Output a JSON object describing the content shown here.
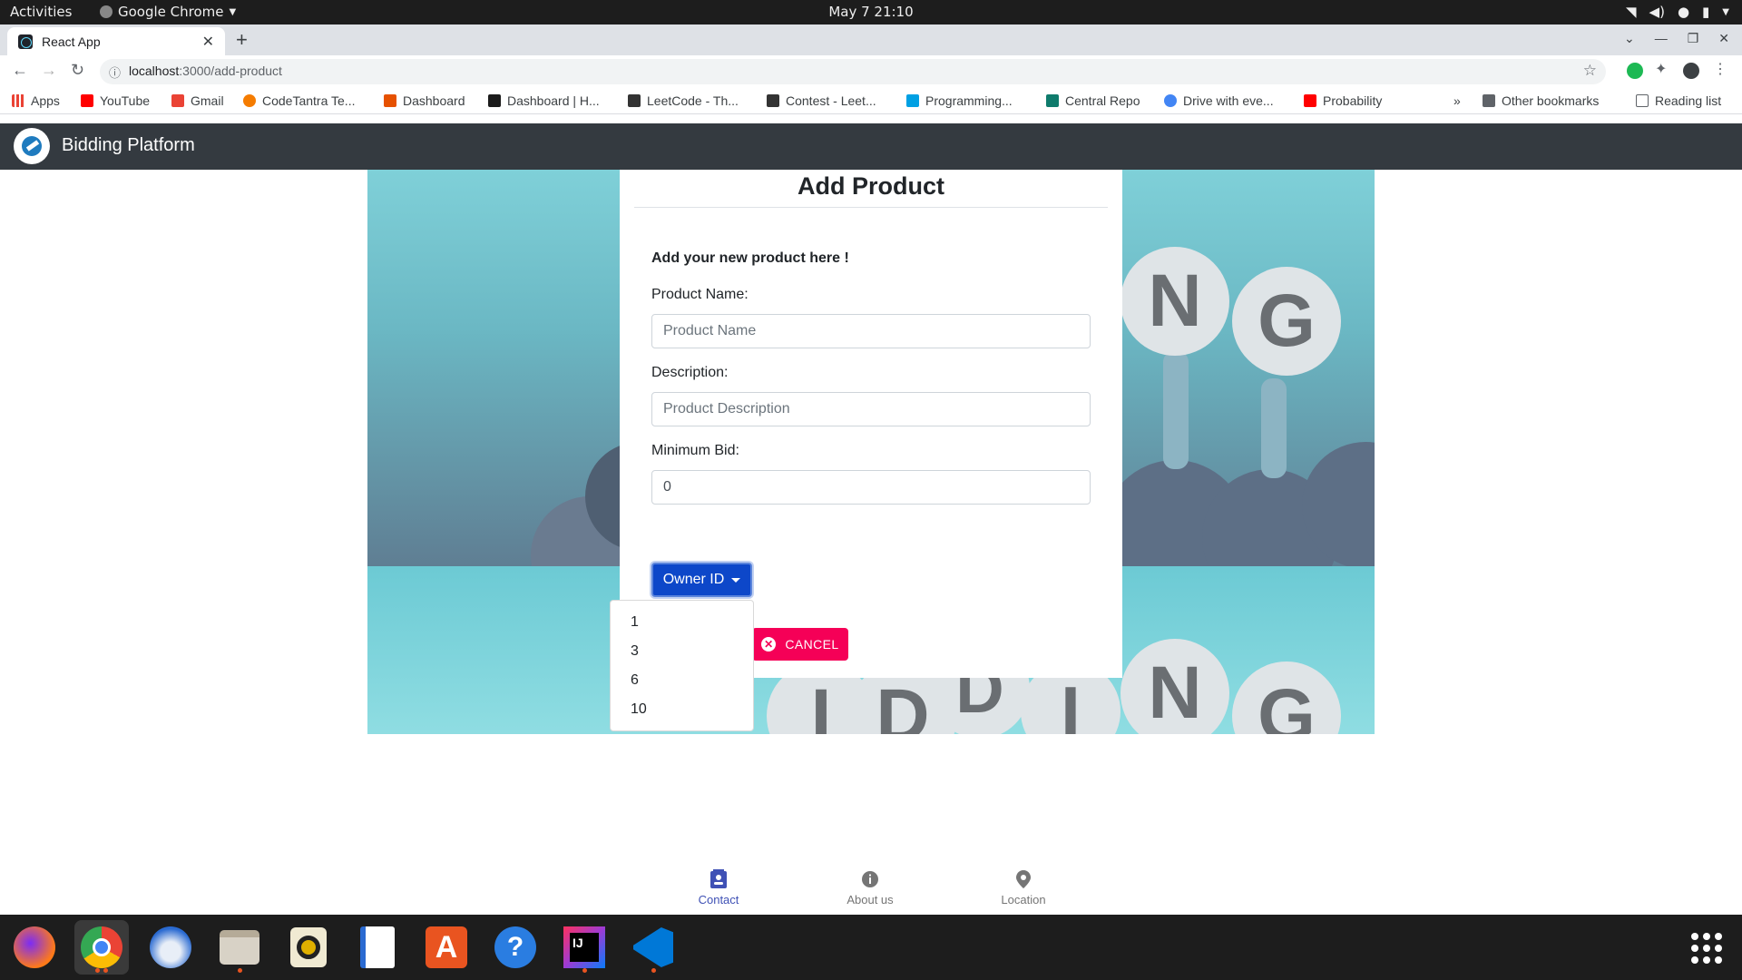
{
  "system_bar": {
    "activities": "Activities",
    "app_name": "Google Chrome",
    "clock": "May 7  21:10"
  },
  "browser": {
    "tab_title": "React App",
    "url_host": "localhost",
    "url_path": ":3000/add-product",
    "bookmarks": [
      {
        "label": "Apps",
        "color": "#ea4335"
      },
      {
        "label": "YouTube",
        "color": "#ff0000"
      },
      {
        "label": "Gmail",
        "color": "#ea4335"
      },
      {
        "label": "CodeTantra Te...",
        "color": "#f57c00"
      },
      {
        "label": "Dashboard",
        "color": "#e65100"
      },
      {
        "label": "Dashboard | H...",
        "color": "#1b1b1b"
      },
      {
        "label": "LeetCode - Th...",
        "color": "#333333"
      },
      {
        "label": "Contest - Leet...",
        "color": "#333333"
      },
      {
        "label": "Programming...",
        "color": "#00a0e3"
      },
      {
        "label": "Central Repo",
        "color": "#0f7b6c"
      },
      {
        "label": "Drive with eve...",
        "color": "#4285f4"
      },
      {
        "label": "Probability",
        "color": "#ff0000"
      }
    ],
    "more_bookmarks": "»",
    "other_bookmarks": "Other bookmarks",
    "reading_list": "Reading list"
  },
  "app": {
    "brand": "Bidding Platform",
    "form": {
      "title": "Add Product",
      "subtitle": "Add your new product here !",
      "product_name_label": "Product Name:",
      "product_name_placeholder": "Product Name",
      "description_label": "Description:",
      "description_placeholder": "Product Description",
      "min_bid_label": "Minimum Bid:",
      "min_bid_value": "0",
      "owner_button": "Owner ID",
      "owner_options": [
        "1",
        "3",
        "6",
        "10"
      ],
      "cancel_button": "CANCEL"
    },
    "bottom_nav": [
      {
        "label": "Contact",
        "active": true
      },
      {
        "label": "About us",
        "active": false
      },
      {
        "label": "Location",
        "active": false
      }
    ],
    "banner_letters_top": [
      "N",
      "G"
    ],
    "banner_letters_bottom": [
      "I",
      "D",
      "D",
      "I",
      "N",
      "G"
    ]
  },
  "colors": {
    "navbar": "#343a40",
    "primary": "#0d47c9",
    "cancel": "#f50057",
    "active_nav": "#3f51b5"
  }
}
